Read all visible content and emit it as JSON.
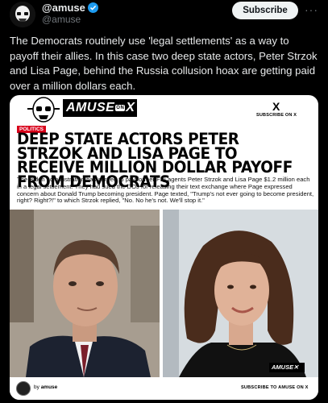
{
  "post": {
    "display_name": "@amuse",
    "handle": "@amuse",
    "subscribe_label": "Subscribe",
    "more_label": "···",
    "text": "The Democrats routinely use 'legal settlements' as a way to payoff their allies. In this case two deep state actors, Peter Strzok and Lisa Page, behind the Russia collusion hoax are getting paid over a million dollars each."
  },
  "card": {
    "logo_text": "AMUSE",
    "logo_on": "ON",
    "logo_x": "X",
    "x_icon": "X",
    "subscribe_top": "SUBSCRIBE ON X",
    "tag": "POLITICS",
    "headline": "DEEP STATE ACTORS PETER STRZOK AND LISA PAGE TO RECEIVE MILLION DOLLAR PAYOFF FROM DEMOCRATS",
    "summary": "The Biden administration has agreed to pay former FBI agents Peter Strzok and Lisa Page $1.2 million each in a legal settlement. They had sued the DOJ for releasing their text exchange where Page expressed concern about Donald Trump becoming president. Page texted, \"Trump's not ever going to become president, right? Right?!\" to which Strzok replied, \"No. No he's not. We'll stop it.\"",
    "badge": "AMUSE✕",
    "footer_by": "by",
    "footer_author": "amuse",
    "footer_subscribe": "SUBSCRIBE TO AMUSE ON X"
  },
  "colors": {
    "accent_blue": "#1d9bf0",
    "politics_red": "#d8001a",
    "background": "#000000"
  },
  "icons": {
    "verified": "verified-badge-icon",
    "more": "more-dots-icon",
    "x": "x-logo-icon"
  }
}
